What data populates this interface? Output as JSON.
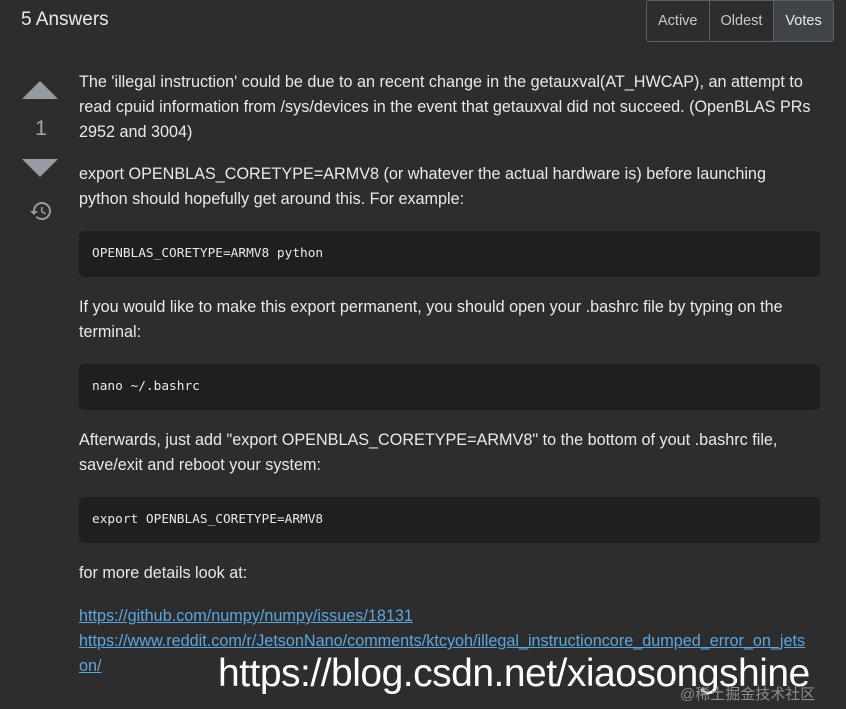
{
  "header": {
    "answers_count": "5 Answers",
    "sort_tabs": [
      "Active",
      "Oldest",
      "Votes"
    ],
    "active_tab": "Votes"
  },
  "vote": {
    "score": "1"
  },
  "answer": {
    "p1": "The 'illegal instruction' could be due to an recent change in the getauxval(AT_HWCAP), an attempt to read cpuid information from /sys/devices in the event that getauxval did not succeed. (OpenBLAS PRs 2952 and 3004)",
    "p2": "export OPENBLAS_CORETYPE=ARMV8 (or whatever the actual hardware is) before launching python should hopefully get around this. For example:",
    "code1": "OPENBLAS_CORETYPE=ARMV8 python",
    "p3": "If you would like to make this export permanent, you should open your .bashrc file by typing on the terminal:",
    "code2": "nano ~/.bashrc",
    "p4": "Afterwards, just add \"export OPENBLAS_CORETYPE=ARMV8\" to the bottom of yout .bashrc file, save/exit and reboot your system:",
    "code3": "export OPENBLAS_CORETYPE=ARMV8",
    "p5": "for more details look at:",
    "link1": "https://github.com/numpy/numpy/issues/18131",
    "link2": "https://www.reddit.com/r/JetsonNano/comments/ktcyoh/illegal_instructioncore_dumped_error_on_jetson/"
  },
  "watermark": {
    "url": "https://blog.csdn.net/xiaosongshine",
    "secondary": "@稀土掘金技术社区"
  },
  "colors": {
    "link": "#5aa7e0",
    "background": "#2d2d2d",
    "code_bg": "#1e1f21"
  }
}
